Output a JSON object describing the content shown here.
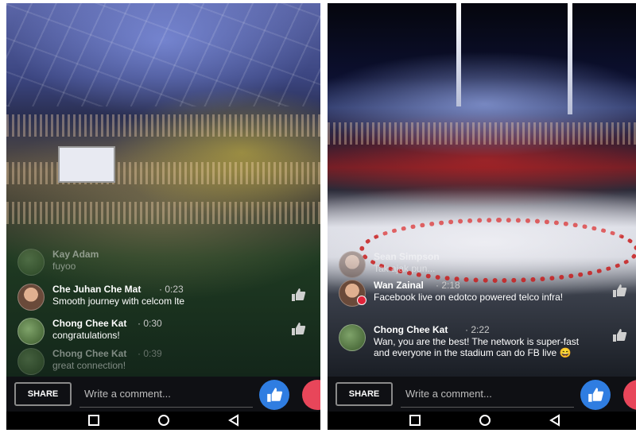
{
  "left_screen": {
    "comments": [
      {
        "name": "Kay Adam",
        "time": "",
        "text": "fuyoo",
        "faded": true
      },
      {
        "name": "Che Juhan Che Mat",
        "time": "· 0:23",
        "text": "Smooth journey with celcom lte",
        "faded": false
      },
      {
        "name": "Chong Chee Kat",
        "time": "· 0:30",
        "text": "congratulations!",
        "faded": false
      },
      {
        "name": "Chong Chee Kat",
        "time": "· 0:39",
        "text": "great connection!",
        "faded": true
      }
    ],
    "share_label": "SHARE",
    "comment_placeholder": "Write a comment..."
  },
  "right_screen": {
    "comments": [
      {
        "name": "Sean Simpson",
        "time": "",
        "text": "Tak ajak pun...",
        "faded": true
      },
      {
        "name": "Wan Zainal",
        "time": "· 2:18",
        "text": "Facebook live on edotco powered telco infra!",
        "faded": false
      },
      {
        "name": "Chong Chee Kat",
        "time": "· 2:22",
        "text": "Wan, you are the best! The network is super-fast and everyone in the stadium can do FB live 😄",
        "faded": false
      }
    ],
    "share_label": "SHARE",
    "comment_placeholder": "Write a comment..."
  },
  "colors": {
    "like_blue": "#2f7de1",
    "love_red": "#e8465a",
    "live_red": "#e0243a"
  },
  "icons": [
    "thumbs-up-icon",
    "heart-icon",
    "back-icon",
    "home-icon",
    "recents-icon"
  ]
}
